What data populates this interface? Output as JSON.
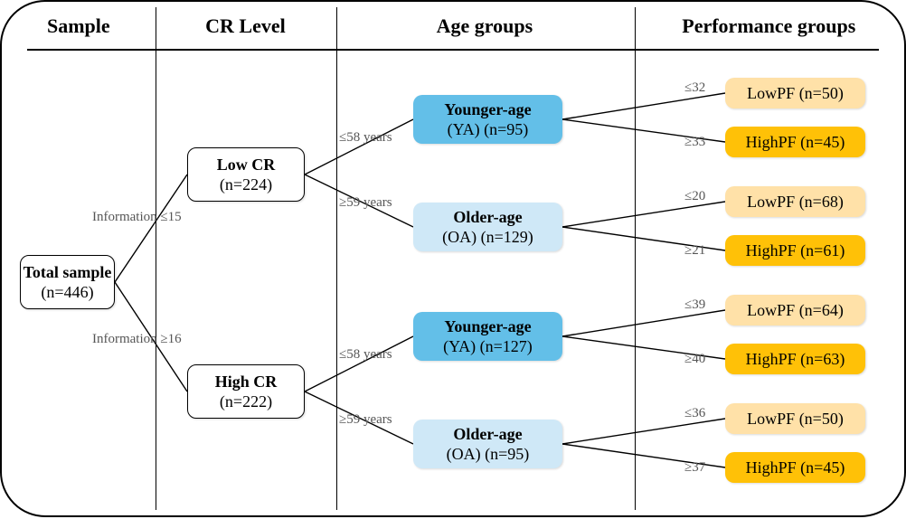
{
  "headers": {
    "sample": "Sample",
    "cr": "CR Level",
    "age": "Age groups",
    "perf": "Performance groups"
  },
  "root": {
    "title": "Total sample",
    "n": "(n=446)"
  },
  "cr": {
    "low": {
      "title": "Low CR",
      "n": "(n=224)",
      "split_label_top": "Information ≤15"
    },
    "high": {
      "title": "High CR",
      "n": "(n=222)",
      "split_label_bottom": "Information ≥16"
    }
  },
  "age": {
    "lowcr": {
      "ya": {
        "title": "Younger-age",
        "sub": "(YA) (n=95)",
        "edge": "≤58 years"
      },
      "oa": {
        "title": "Older-age",
        "sub": "(OA) (n=129)",
        "edge": "≥59 years"
      }
    },
    "highcr": {
      "ya": {
        "title": "Younger-age",
        "sub": "(YA) (n=127)",
        "edge": "≤58 years"
      },
      "oa": {
        "title": "Older-age",
        "sub": "(OA) (n=95)",
        "edge": "≥59 years"
      }
    }
  },
  "perf": {
    "lowcr_ya": {
      "low": "LowPF (n=50)",
      "high": "HighPF (n=45)",
      "edge_low": "≤32",
      "edge_high": "≥33"
    },
    "lowcr_oa": {
      "low": "LowPF (n=68)",
      "high": "HighPF (n=61)",
      "edge_low": "≤20",
      "edge_high": "≥21"
    },
    "highcr_ya": {
      "low": "LowPF (n=64)",
      "high": "HighPF (n=63)",
      "edge_low": "≤39",
      "edge_high": "≥40"
    },
    "highcr_oa": {
      "low": "LowPF (n=50)",
      "high": "HighPF (n=45)",
      "edge_low": "≤36",
      "edge_high": "≥37"
    }
  },
  "colors": {
    "blue_strong": "#63bfe8",
    "blue_light": "#cfe8f7",
    "gold_strong": "#ffc107",
    "gold_light": "#ffe1a8"
  }
}
